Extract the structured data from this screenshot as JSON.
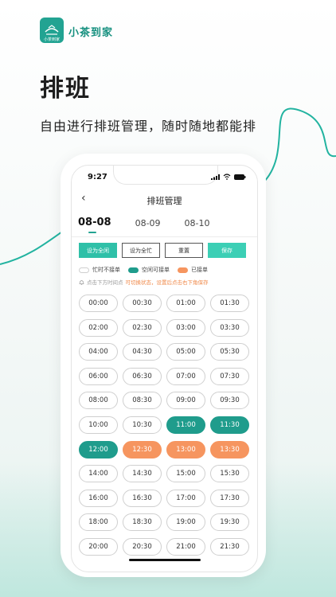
{
  "brand": {
    "name": "小茶到家",
    "logo_sub": "小茶到家"
  },
  "promo": {
    "headline": "排班",
    "subline": "自由进行排班管理，随时随地都能排"
  },
  "status_bar": {
    "time": "9:27"
  },
  "nav": {
    "title": "排班管理",
    "back_icon": "chevron-left-icon"
  },
  "dates": [
    "08-08",
    "08-09",
    "08-10"
  ],
  "active_date_index": 0,
  "actions": {
    "set_all_free": "设为全闲",
    "set_all_busy": "设为全忙",
    "reset": "重置",
    "save": "保存"
  },
  "legend": {
    "busy": "忙时不接单",
    "free": "空闲可接单",
    "booked": "已接单"
  },
  "hint": {
    "prefix": "点击下方时间点",
    "highlight": "可切换状态，设置后点击右下角保存"
  },
  "colors": {
    "accent": "#22a392",
    "free": "#1f9c8c",
    "booked": "#f6955f",
    "save": "#3ccfb5"
  },
  "slots": [
    {
      "time": "00:00",
      "state": "busy"
    },
    {
      "time": "00:30",
      "state": "busy"
    },
    {
      "time": "01:00",
      "state": "busy"
    },
    {
      "time": "01:30",
      "state": "busy"
    },
    {
      "time": "02:00",
      "state": "busy"
    },
    {
      "time": "02:30",
      "state": "busy"
    },
    {
      "time": "03:00",
      "state": "busy"
    },
    {
      "time": "03:30",
      "state": "busy"
    },
    {
      "time": "04:00",
      "state": "busy"
    },
    {
      "time": "04:30",
      "state": "busy"
    },
    {
      "time": "05:00",
      "state": "busy"
    },
    {
      "time": "05:30",
      "state": "busy"
    },
    {
      "time": "06:00",
      "state": "busy"
    },
    {
      "time": "06:30",
      "state": "busy"
    },
    {
      "time": "07:00",
      "state": "busy"
    },
    {
      "time": "07:30",
      "state": "busy"
    },
    {
      "time": "08:00",
      "state": "busy"
    },
    {
      "time": "08:30",
      "state": "busy"
    },
    {
      "time": "09:00",
      "state": "busy"
    },
    {
      "time": "09:30",
      "state": "busy"
    },
    {
      "time": "10:00",
      "state": "busy"
    },
    {
      "time": "10:30",
      "state": "busy"
    },
    {
      "time": "11:00",
      "state": "free"
    },
    {
      "time": "11:30",
      "state": "free"
    },
    {
      "time": "12:00",
      "state": "free"
    },
    {
      "time": "12:30",
      "state": "booked"
    },
    {
      "time": "13:00",
      "state": "booked"
    },
    {
      "time": "13:30",
      "state": "booked"
    },
    {
      "time": "14:00",
      "state": "busy"
    },
    {
      "time": "14:30",
      "state": "busy"
    },
    {
      "time": "15:00",
      "state": "busy"
    },
    {
      "time": "15:30",
      "state": "busy"
    },
    {
      "time": "16:00",
      "state": "busy"
    },
    {
      "time": "16:30",
      "state": "busy"
    },
    {
      "time": "17:00",
      "state": "busy"
    },
    {
      "time": "17:30",
      "state": "busy"
    },
    {
      "time": "18:00",
      "state": "busy"
    },
    {
      "time": "18:30",
      "state": "busy"
    },
    {
      "time": "19:00",
      "state": "busy"
    },
    {
      "time": "19:30",
      "state": "busy"
    },
    {
      "time": "20:00",
      "state": "busy"
    },
    {
      "time": "20:30",
      "state": "busy"
    },
    {
      "time": "21:00",
      "state": "busy"
    },
    {
      "time": "21:30",
      "state": "busy"
    }
  ]
}
